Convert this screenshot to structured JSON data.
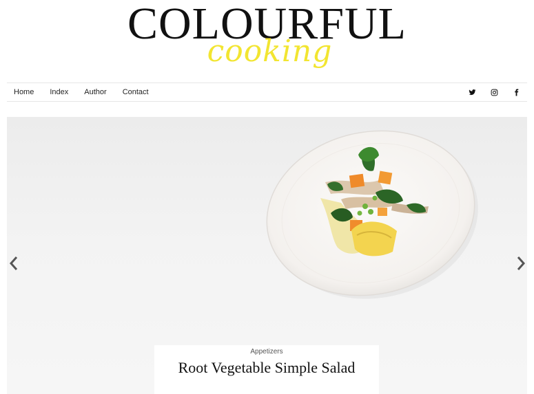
{
  "logo": {
    "main": "COLOURFUL",
    "script": "cooking"
  },
  "nav": {
    "items": [
      {
        "label": "Home"
      },
      {
        "label": "Index"
      },
      {
        "label": "Author"
      },
      {
        "label": "Contact"
      }
    ]
  },
  "social": {
    "icons": [
      "twitter-icon",
      "instagram-icon",
      "facebook-icon"
    ]
  },
  "slider": {
    "image": "plate-of-root-vegetable-salad",
    "prev_icon": "chevron-left-icon",
    "next_icon": "chevron-right-icon"
  },
  "featured": {
    "category": "Appetizers",
    "title": "Root Vegetable Simple Salad",
    "meta": ""
  },
  "colors": {
    "brand_script": "#f2e531",
    "text": "#111111",
    "nav_border": "#e6e6e6"
  }
}
